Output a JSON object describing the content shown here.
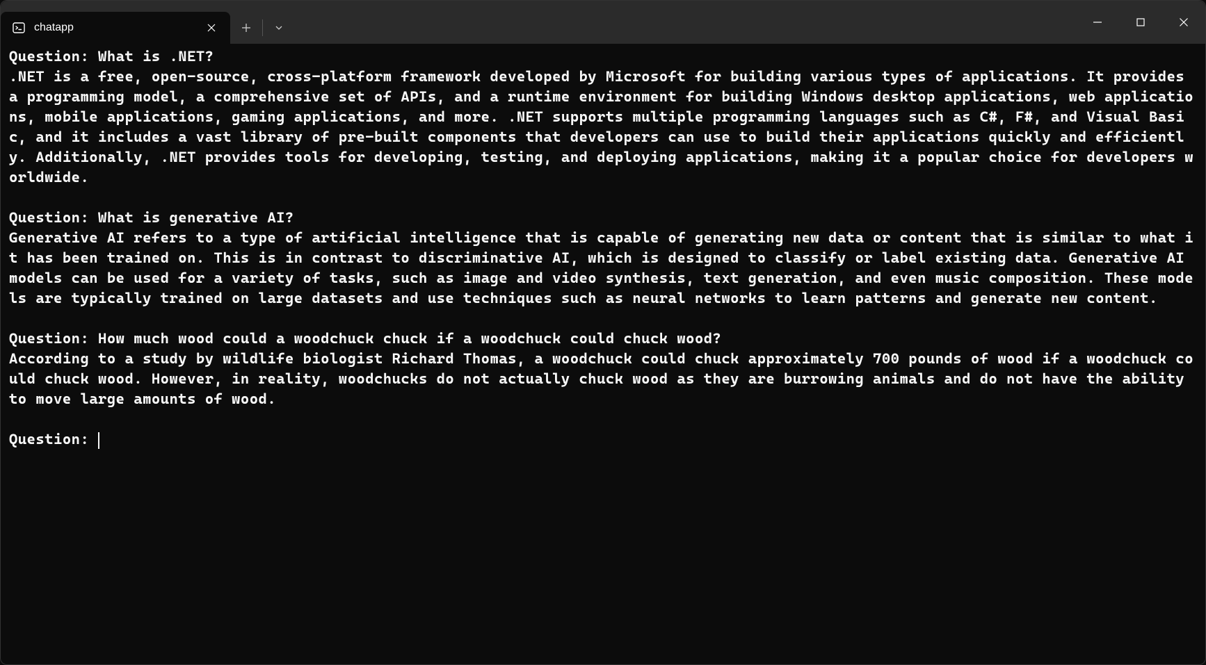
{
  "tab": {
    "title": "chatapp"
  },
  "terminal": {
    "qa": [
      {
        "question": "Question: What is .NET?",
        "answer": ".NET is a free, open-source, cross-platform framework developed by Microsoft for building various types of applications. It provides a programming model, a comprehensive set of APIs, and a runtime environment for building Windows desktop applications, web applications, mobile applications, gaming applications, and more. .NET supports multiple programming languages such as C#, F#, and Visual Basic, and it includes a vast library of pre-built components that developers can use to build their applications quickly and efficiently. Additionally, .NET provides tools for developing, testing, and deploying applications, making it a popular choice for developers worldwide."
      },
      {
        "question": "Question: What is generative AI?",
        "answer": "Generative AI refers to a type of artificial intelligence that is capable of generating new data or content that is similar to what it has been trained on. This is in contrast to discriminative AI, which is designed to classify or label existing data. Generative AI models can be used for a variety of tasks, such as image and video synthesis, text generation, and even music composition. These models are typically trained on large datasets and use techniques such as neural networks to learn patterns and generate new content."
      },
      {
        "question": "Question: How much wood could a woodchuck chuck if a woodchuck could chuck wood?",
        "answer": "According to a study by wildlife biologist Richard Thomas, a woodchuck could chuck approximately 700 pounds of wood if a woodchuck could chuck wood. However, in reality, woodchucks do not actually chuck wood as they are burrowing animals and do not have the ability to move large amounts of wood."
      }
    ],
    "prompt": "Question: "
  }
}
